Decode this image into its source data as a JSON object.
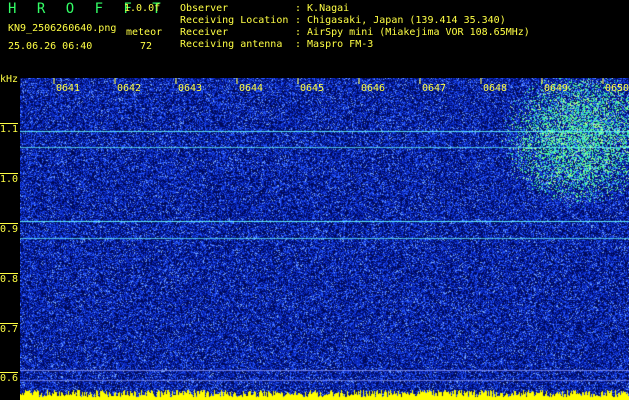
{
  "header": {
    "brand": "H R O F F T",
    "version": "1.0.0f",
    "filename": "KN9_2506260640.png",
    "mode": "meteor",
    "datetime": "25.06.26 06:40",
    "rate": "72",
    "meta": [
      {
        "key": "Observer",
        "value": ": K.Nagai"
      },
      {
        "key": "Receiving Location",
        "value": ": Chigasaki, Japan (139.414 35.340)"
      },
      {
        "key": "Receiver",
        "value": ": AirSpy mini (Miakejima VOR 108.65MHz)"
      },
      {
        "key": "Receiving antenna",
        "value": ": Maspro FM-3"
      }
    ]
  },
  "axis": {
    "y_unit": "kHz",
    "y_ticks": [
      "1.1",
      "1.0",
      "0.9",
      "0.8",
      "0.7",
      "0.6"
    ],
    "x_ticks": [
      "0641",
      "0642",
      "0643",
      "0644",
      "0645",
      "0646",
      "0647",
      "0648",
      "0649",
      "0650"
    ]
  },
  "colors": {
    "background": "#000000",
    "text": "#ffff44",
    "brand": "#33ff66",
    "noise_low": "#001a80",
    "noise_mid": "#2255ff",
    "signal": "#66ffff",
    "meteor": "#44ff88",
    "bottom_bar": "#ffff00"
  }
}
